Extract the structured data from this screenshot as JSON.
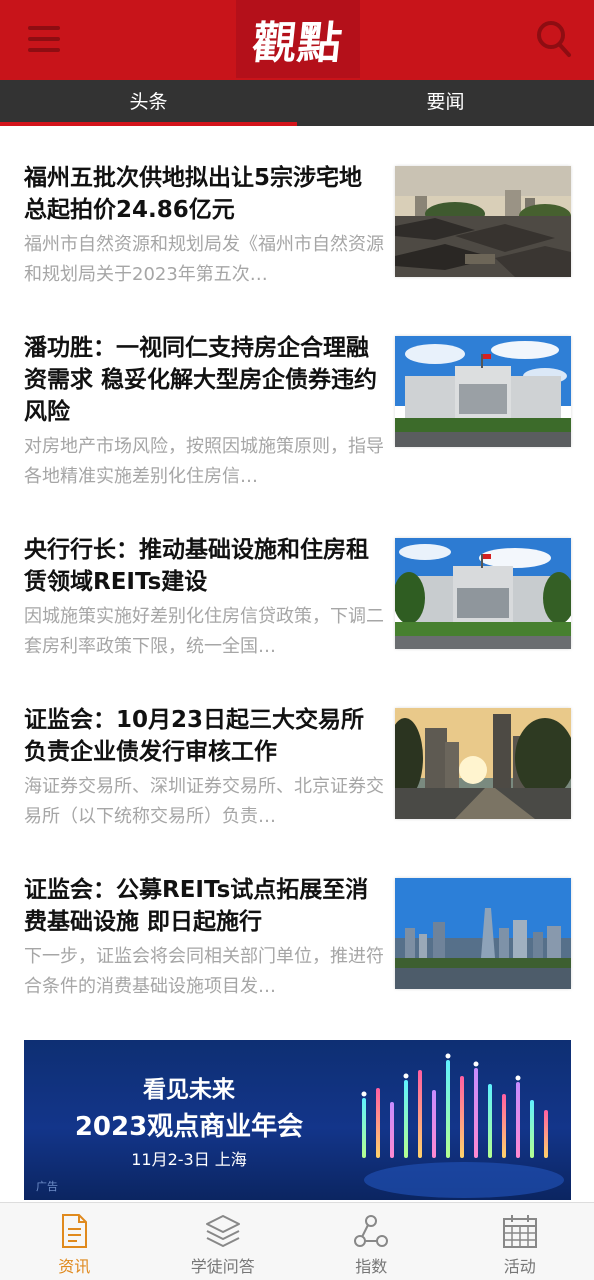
{
  "header": {
    "logo_text": "觀點"
  },
  "tabs": [
    {
      "label": "头条",
      "active": true
    },
    {
      "label": "要闻",
      "active": false
    }
  ],
  "news": [
    {
      "title": "福州五批次供地拟出让5宗涉宅地 总起拍价24.86亿元",
      "summary": "福州市自然资源和规划局发《福州市自然资源和规划局关于2023年第五次…",
      "image": "old-town-rooftops"
    },
    {
      "title": "潘功胜：一视同仁支持房企合理融资需求 稳妥化解大型房企债券违约风险",
      "summary": "对房地产市场风险，按照因城施策原则，指导各地精准实施差别化住房信…",
      "image": "central-bank-building"
    },
    {
      "title": "央行行长：推动基础设施和住房租赁领域REITs建设",
      "summary": "因城施策实施好差别化住房信贷政策，下调二套房利率政策下限，统一全国…",
      "image": "central-bank-building-2"
    },
    {
      "title": "证监会：10月23日起三大交易所负责企业债发行审核工作",
      "summary": "海证券交易所、深圳证券交易所、北京证券交易所（以下统称交易所）负责…",
      "image": "city-sunset-skyscrapers"
    },
    {
      "title": "证监会：公募REITs试点拓展至消费基础设施 即日起施行",
      "summary": "下一步，证监会将会同相关部门单位，推进符合条件的消费基础设施项目发…",
      "image": "city-skyline"
    }
  ],
  "ad": {
    "line1": "看见未来",
    "line2": "2023观点商业年会",
    "line3": "11月2-3日  上海",
    "tag": "广告"
  },
  "bottom_nav": [
    {
      "label": "资讯",
      "icon": "document-icon",
      "active": true
    },
    {
      "label": "学徒问答",
      "icon": "layers-icon",
      "active": false
    },
    {
      "label": "指数",
      "icon": "network-icon",
      "active": false
    },
    {
      "label": "活动",
      "icon": "calendar-icon",
      "active": false
    }
  ],
  "colors": {
    "brand_red": "#c8141a",
    "tab_bar": "#333333",
    "active_nav": "#e08a1e"
  }
}
